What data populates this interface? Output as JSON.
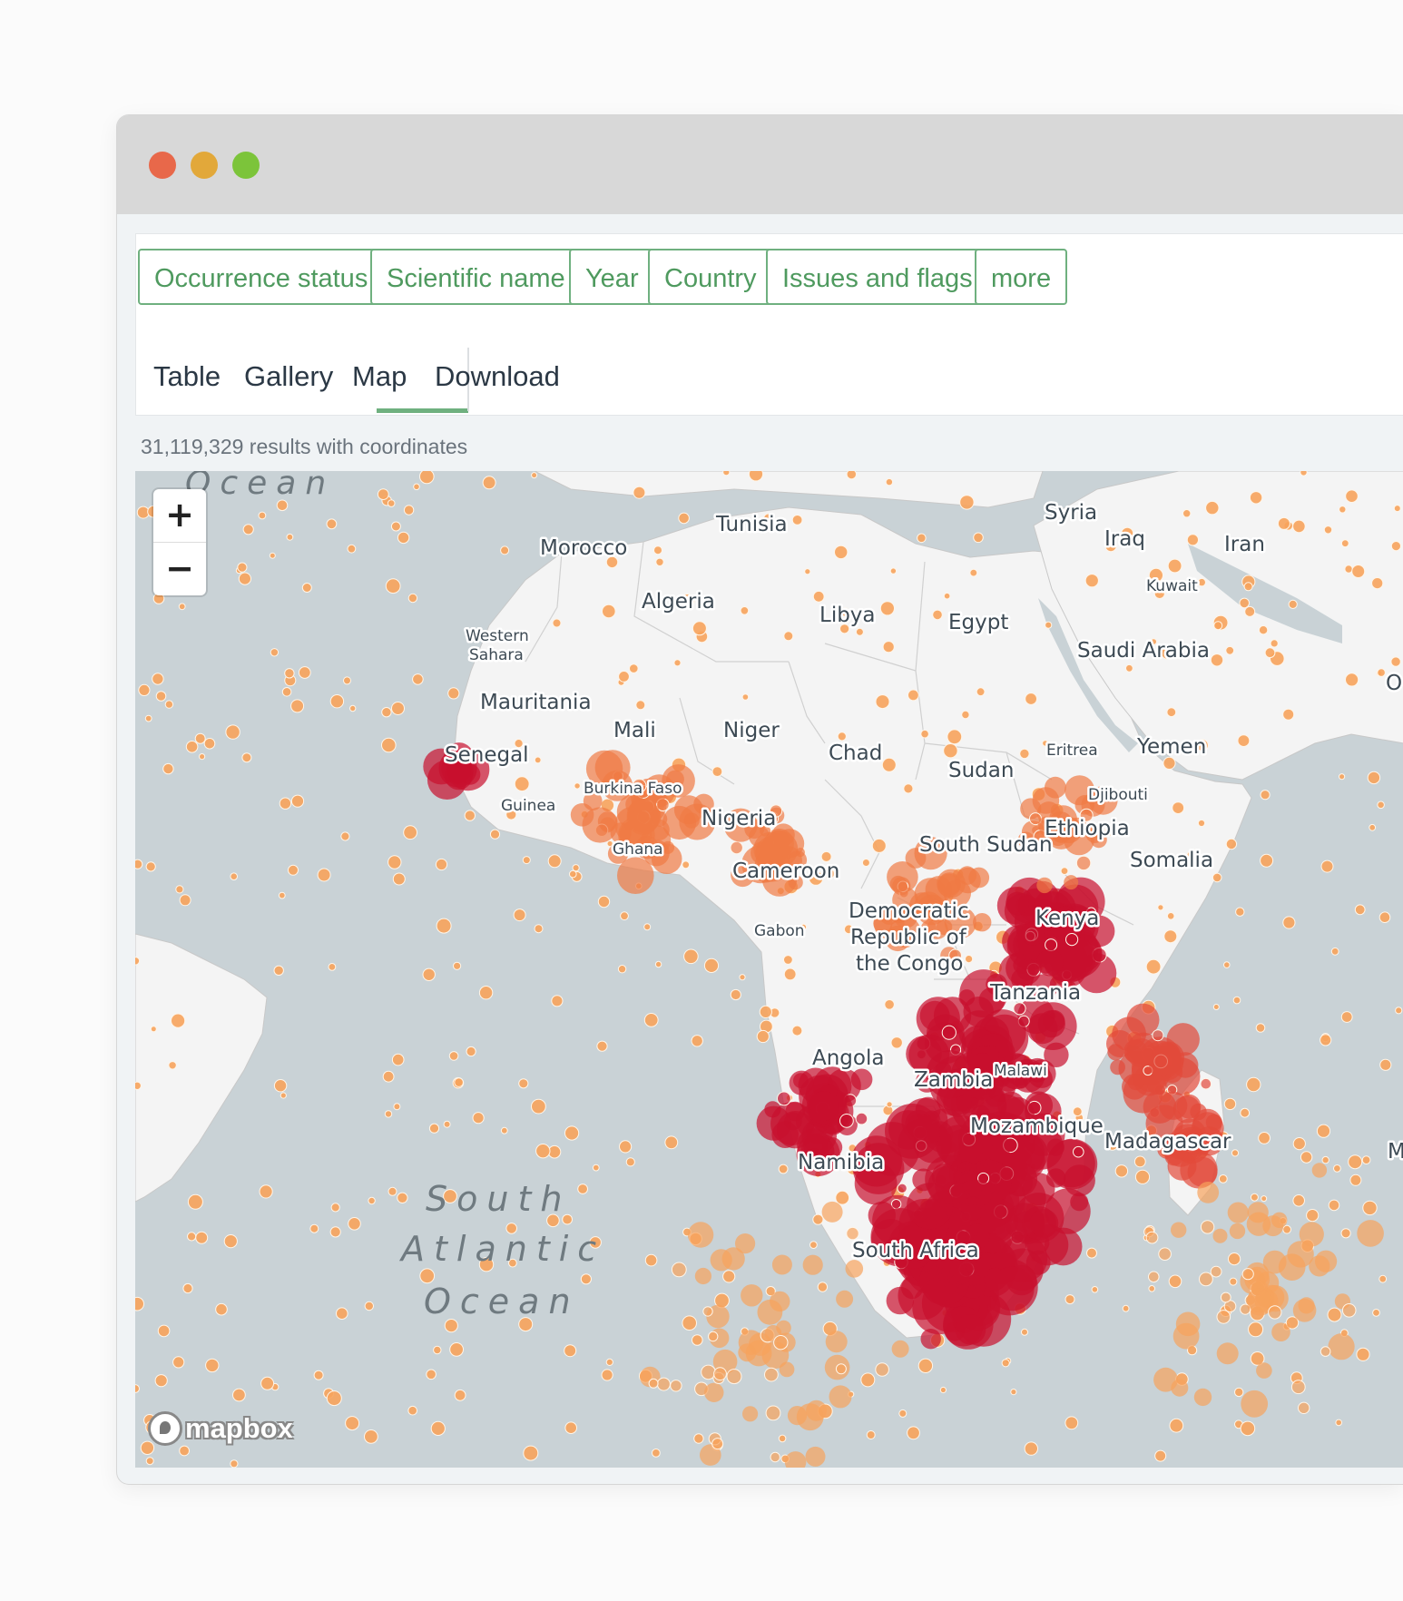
{
  "window": {
    "controls": [
      "close",
      "minimize",
      "zoom"
    ]
  },
  "filters": [
    "Occurrence status",
    "Scientific name",
    "Year",
    "Country",
    "Issues and flags",
    "more"
  ],
  "tabs": [
    "Table",
    "Gallery",
    "Map",
    "Download"
  ],
  "active_tab": "Map",
  "results_text": "31,119,329 results with coordinates",
  "zoom": {
    "in": "+",
    "out": "−"
  },
  "attribution": "mapbox",
  "map": {
    "oceans": [
      "Ocean",
      "South",
      "Atlantic",
      "Ocean"
    ],
    "countries": [
      "Tunisia",
      "Morocco",
      "Algeria",
      "Libya",
      "Egypt",
      "Syria",
      "Iraq",
      "Iran",
      "Kuwait",
      "Saudi Arabia",
      "O",
      "Western",
      "Sahara",
      "Mauritania",
      "Mali",
      "Niger",
      "Chad",
      "Sudan",
      "Eritrea",
      "Yemen",
      "Senegal",
      "Burkina Faso",
      "Guinea",
      "Nigeria",
      "Djibouti",
      "Ethiopia",
      "Ghana",
      "South Sudan",
      "Somalia",
      "Cameroon",
      "Democratic",
      "Republic of",
      "the Congo",
      "Kenya",
      "Gabon",
      "Tanzania",
      "Angola",
      "Malawi",
      "Zambia",
      "Mozambique",
      "Madagascar",
      "M",
      "Namibia",
      "South Africa"
    ],
    "colors": {
      "water": "#c9d2d6",
      "land": "#f4f4f4",
      "point_light": "#f7a35c",
      "point_dark": "#c8102e"
    }
  }
}
